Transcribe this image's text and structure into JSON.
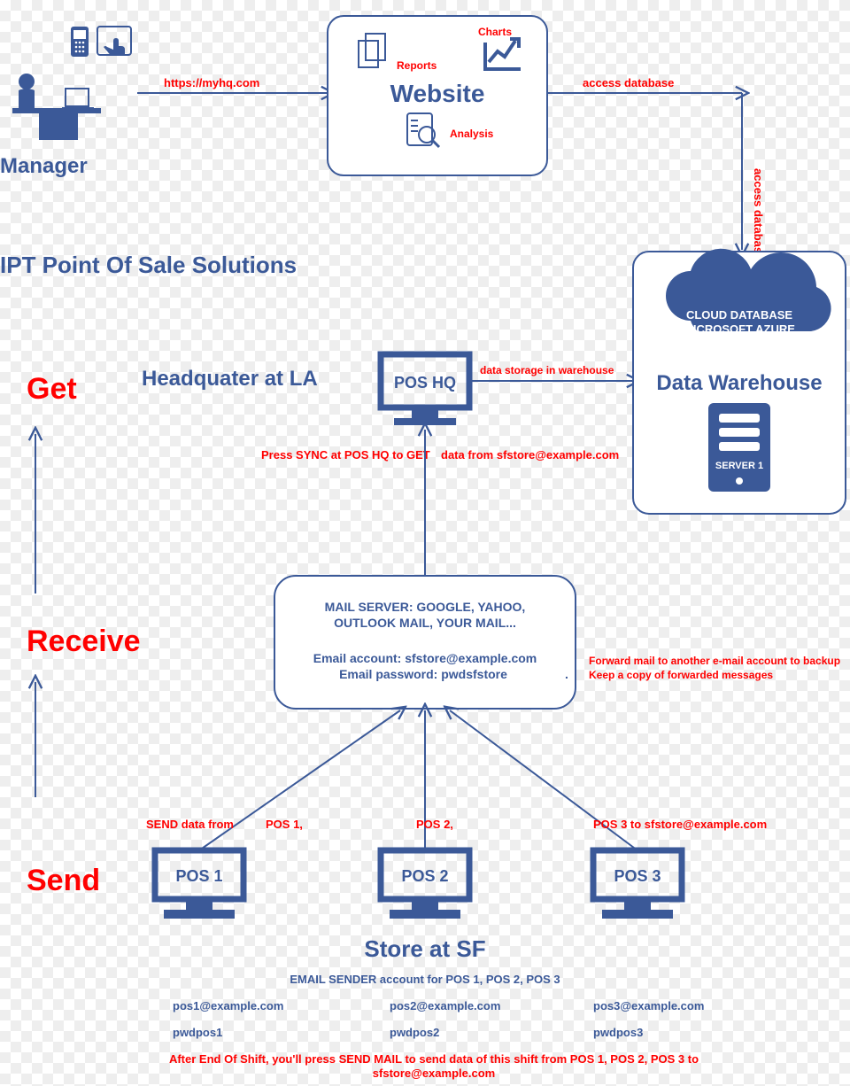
{
  "title": "IPT Point Of Sale Solutions",
  "manager": {
    "label": "Manager",
    "url": "https://myhq.com"
  },
  "website": {
    "label": "Website",
    "reports": "Reports",
    "charts": "Charts",
    "analysis": "Analysis",
    "access_db_right": "access database",
    "access_db_down": "access database"
  },
  "steps": {
    "get": "Get",
    "receive": "Receive",
    "send": "Send"
  },
  "hq": {
    "label": "Headquater at LA",
    "monitor": "POS HQ",
    "storage_arrow": "data storage in warehouse",
    "sync_line1": "Press SYNC at POS HQ to GET",
    "sync_line2": "data from sfstore@example.com"
  },
  "warehouse": {
    "label": "Data Warehouse",
    "cloud_line1": "CLOUD DATABASE",
    "cloud_line2": "MICROSOFT AZURE",
    "server_label": "SERVER 1"
  },
  "mailserver": {
    "line1": "MAIL SERVER: GOOGLE, YAHOO,",
    "line2": "OUTLOOK MAIL, YOUR MAIL...",
    "account_label": "Email account: sfstore@example.com",
    "password_label": "Email password: pwdsfstore",
    "forward1": "Forward mail to another e-mail account to backup",
    "forward2": "Keep a copy of forwarded messages"
  },
  "send": {
    "prefix": "SEND data from",
    "p1": "POS 1,",
    "p2": "POS 2,",
    "p3": "POS 3 to sfstore@example.com"
  },
  "store": {
    "label": "Store at SF",
    "pos1": "POS 1",
    "pos2": "POS 2",
    "pos3": "POS 3"
  },
  "footer": {
    "header": "EMAIL SENDER account for POS 1, POS 2, POS 3",
    "emails": [
      "pos1@example.com",
      "pos2@example.com",
      "pos3@example.com"
    ],
    "passwords": [
      "pwdpos1",
      "pwdpos2",
      "pwdpos3"
    ],
    "note1": "After End Of Shift, you'll press SEND MAIL to send data of this shift from POS 1, POS 2, POS 3 to",
    "note2": "sfstore@example.com"
  }
}
